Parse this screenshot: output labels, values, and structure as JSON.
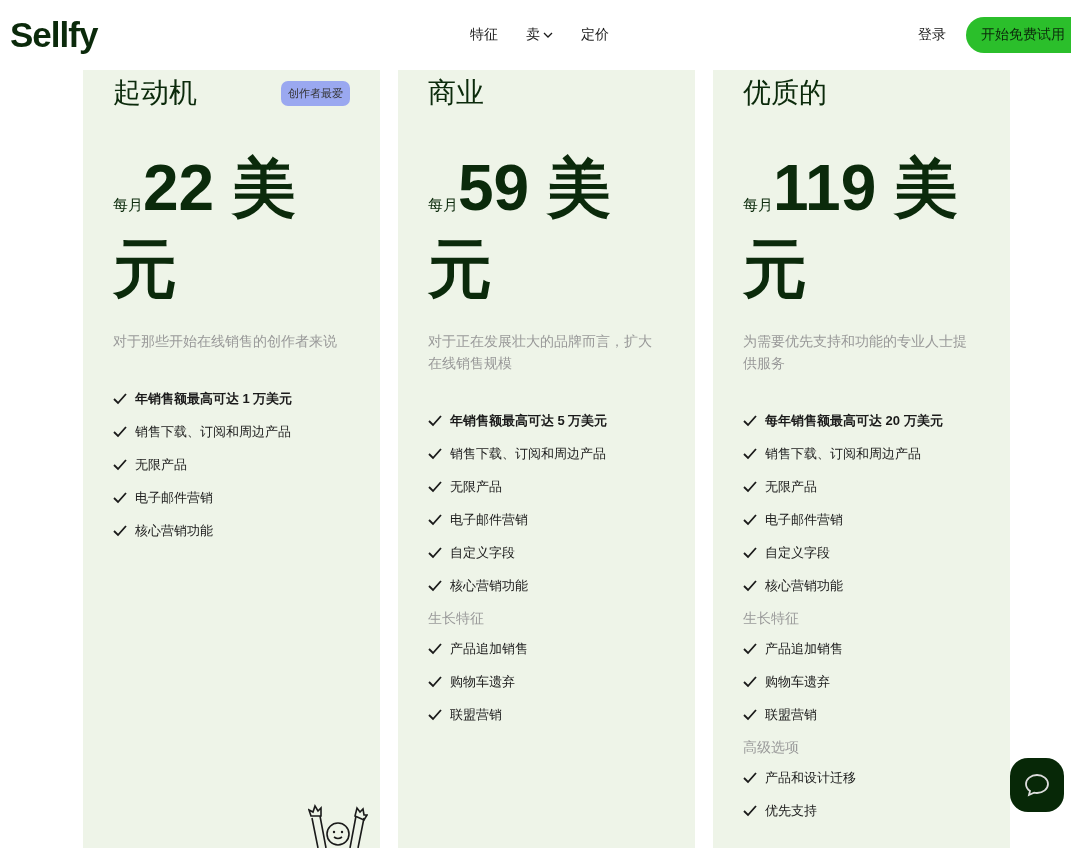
{
  "header": {
    "logo": "Sellfy",
    "nav": [
      {
        "label": "特征",
        "dropdown": false
      },
      {
        "label": "卖",
        "dropdown": true
      },
      {
        "label": "定价",
        "dropdown": false
      }
    ],
    "login": "登录",
    "cta": "开始免费试用"
  },
  "plans": [
    {
      "name": "起动机",
      "badge": "创作者最爱",
      "period": "每月",
      "price": "22 美元",
      "description": "对于那些开始在线销售的创作者来说",
      "mascot": true,
      "sections": [
        {
          "features": [
            {
              "text": "年销售额最高可达 1 万美元",
              "highlight": true
            },
            {
              "text": "销售下载、订阅和周边产品",
              "highlight": false
            },
            {
              "text": "无限产品",
              "highlight": false
            },
            {
              "text": "电子邮件营销",
              "highlight": false
            },
            {
              "text": "核心营销功能",
              "highlight": false
            }
          ]
        }
      ]
    },
    {
      "name": "商业",
      "period": "每月",
      "price": "59 美元",
      "description": "对于正在发展壮大的品牌而言，扩大在线销售规模",
      "mascot": false,
      "sections": [
        {
          "features": [
            {
              "text": "年销售额最高可达 5 万美元",
              "highlight": true
            },
            {
              "text": "销售下载、订阅和周边产品",
              "highlight": false
            },
            {
              "text": "无限产品",
              "highlight": false
            },
            {
              "text": "电子邮件营销",
              "highlight": false
            },
            {
              "text": "自定义字段",
              "highlight": false
            },
            {
              "text": "核心营销功能",
              "highlight": false
            }
          ]
        },
        {
          "heading": "生长特征",
          "features": [
            {
              "text": "产品追加销售",
              "highlight": false
            },
            {
              "text": "购物车遗弃",
              "highlight": false
            },
            {
              "text": "联盟营销",
              "highlight": false
            }
          ]
        }
      ]
    },
    {
      "name": "优质的",
      "period": "每月",
      "price": "119 美元",
      "description": "为需要优先支持和功能的专业人士提供服务",
      "mascot": false,
      "sections": [
        {
          "features": [
            {
              "text": "每年销售额最高可达 20 万美元",
              "highlight": true
            },
            {
              "text": "销售下载、订阅和周边产品",
              "highlight": false
            },
            {
              "text": "无限产品",
              "highlight": false
            },
            {
              "text": "电子邮件营销",
              "highlight": false
            },
            {
              "text": "自定义字段",
              "highlight": false
            },
            {
              "text": "核心营销功能",
              "highlight": false
            }
          ]
        },
        {
          "heading": "生长特征",
          "features": [
            {
              "text": "产品追加销售",
              "highlight": false
            },
            {
              "text": "购物车遗弃",
              "highlight": false
            },
            {
              "text": "联盟营销",
              "highlight": false
            }
          ]
        },
        {
          "heading": "高级选项",
          "features": [
            {
              "text": "产品和设计迁移",
              "highlight": false
            },
            {
              "text": "优先支持",
              "highlight": false
            }
          ]
        }
      ]
    }
  ],
  "chat_button": true
}
